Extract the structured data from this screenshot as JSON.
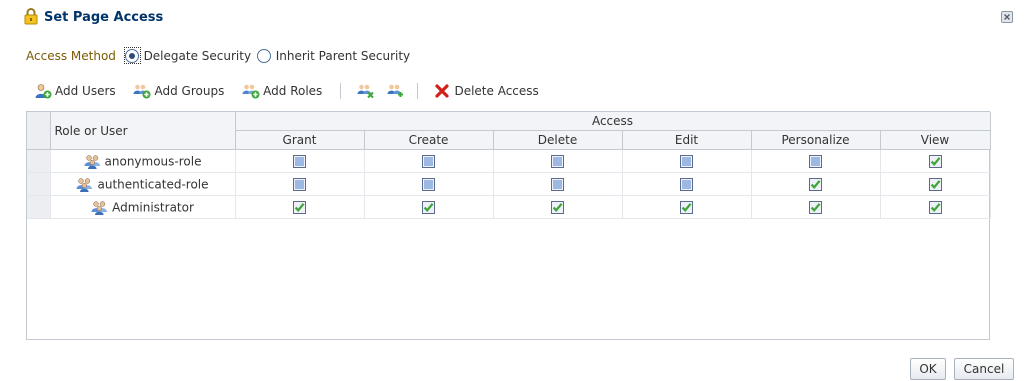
{
  "dialog": {
    "title": "Set Page Access"
  },
  "access_method": {
    "label": "Access Method",
    "options": [
      {
        "label": "Delegate Security",
        "selected": true
      },
      {
        "label": "Inherit Parent Security",
        "selected": false
      }
    ]
  },
  "toolbar": {
    "add_users": "Add Users",
    "add_groups": "Add Groups",
    "add_roles": "Add Roles",
    "delete_access": "Delete Access"
  },
  "table": {
    "role_header": "Role or User",
    "access_header": "Access",
    "columns": [
      "Grant",
      "Create",
      "Delete",
      "Edit",
      "Personalize",
      "View"
    ],
    "rows": [
      {
        "name": "anonymous-role",
        "icon": "role-icon",
        "perms": [
          false,
          false,
          false,
          false,
          false,
          true
        ]
      },
      {
        "name": "authenticated-role",
        "icon": "role-icon",
        "perms": [
          false,
          false,
          false,
          false,
          true,
          true
        ]
      },
      {
        "name": "Administrator",
        "icon": "role-icon",
        "perms": [
          true,
          true,
          true,
          true,
          true,
          true
        ]
      }
    ]
  },
  "buttons": {
    "ok": "OK",
    "cancel": "Cancel"
  },
  "colors": {
    "title": "#00346a",
    "label_accent": "#7a5a00",
    "checkbox_checked": "#3fa639",
    "delete_icon": "#d0201a",
    "header_bg": "#f2f4f7"
  }
}
